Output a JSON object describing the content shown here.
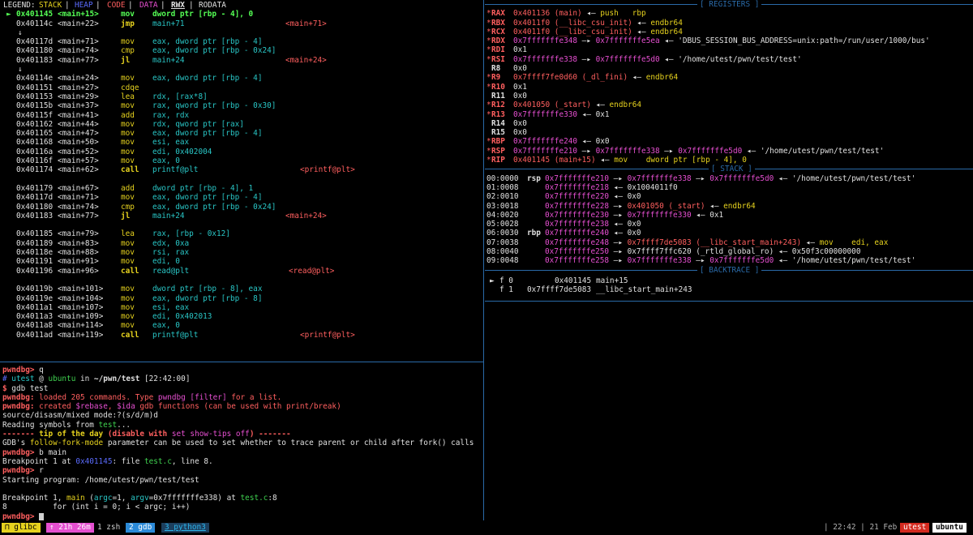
{
  "legend": {
    "label": "LEGEND:",
    "stack": "STACK",
    "heap": "HEAP",
    "code": "CODE",
    "data": "DATA",
    "rwx": "RWX",
    "rodata": "RODATA"
  },
  "disasm": [
    {
      "marker": "►",
      "addr": "0x401145",
      "func": "<main+15>",
      "mnem": "mov",
      "ops": "dword ptr [rbp - 4], 0",
      "tgt": "",
      "current": true
    },
    {
      "marker": "",
      "addr": "0x40114c",
      "func": "<main+22>",
      "mnem": "jmp",
      "ops": "main+71",
      "tgt": "<main+71>"
    },
    {
      "marker": "↓",
      "spacer": true
    },
    {
      "marker": "",
      "addr": "0x40117d",
      "func": "<main+71>",
      "mnem": "mov",
      "ops": "eax, dword ptr [rbp - 4]",
      "tgt": ""
    },
    {
      "marker": "",
      "addr": "0x401180",
      "func": "<main+74>",
      "mnem": "cmp",
      "ops": "eax, dword ptr [rbp - 0x24]",
      "tgt": ""
    },
    {
      "marker": "",
      "addr": "0x401183",
      "func": "<main+77>",
      "mnem": "jl",
      "ops": "main+24",
      "tgt": "<main+24>"
    },
    {
      "marker": "↓",
      "spacer": true
    },
    {
      "marker": "",
      "addr": "0x40114e",
      "func": "<main+24>",
      "mnem": "mov",
      "ops": "eax, dword ptr [rbp - 4]",
      "tgt": ""
    },
    {
      "marker": "",
      "addr": "0x401151",
      "func": "<main+27>",
      "mnem": "cdqe",
      "ops": "",
      "tgt": ""
    },
    {
      "marker": "",
      "addr": "0x401153",
      "func": "<main+29>",
      "mnem": "lea",
      "ops": "rdx, [rax*8]",
      "tgt": ""
    },
    {
      "marker": "",
      "addr": "0x40115b",
      "func": "<main+37>",
      "mnem": "mov",
      "ops": "rax, qword ptr [rbp - 0x30]",
      "tgt": ""
    },
    {
      "marker": "",
      "addr": "0x40115f",
      "func": "<main+41>",
      "mnem": "add",
      "ops": "rax, rdx",
      "tgt": ""
    },
    {
      "marker": "",
      "addr": "0x401162",
      "func": "<main+44>",
      "mnem": "mov",
      "ops": "rdx, qword ptr [rax]",
      "tgt": ""
    },
    {
      "marker": "",
      "addr": "0x401165",
      "func": "<main+47>",
      "mnem": "mov",
      "ops": "eax, dword ptr [rbp - 4]",
      "tgt": ""
    },
    {
      "marker": "",
      "addr": "0x401168",
      "func": "<main+50>",
      "mnem": "mov",
      "ops": "esi, eax",
      "tgt": ""
    },
    {
      "marker": "",
      "addr": "0x40116a",
      "func": "<main+52>",
      "mnem": "mov",
      "ops": "edi, 0x402004",
      "tgt": ""
    },
    {
      "marker": "",
      "addr": "0x40116f",
      "func": "<main+57>",
      "mnem": "mov",
      "ops": "eax, 0",
      "tgt": ""
    },
    {
      "marker": "",
      "addr": "0x401174",
      "func": "<main+62>",
      "mnem": "call",
      "ops": "printf@plt",
      "tgt": "<printf@plt>"
    },
    {
      "spacer": true,
      "marker": ""
    },
    {
      "marker": "",
      "addr": "0x401179",
      "func": "<main+67>",
      "mnem": "add",
      "ops": "dword ptr [rbp - 4], 1",
      "tgt": ""
    },
    {
      "marker": "",
      "addr": "0x40117d",
      "func": "<main+71>",
      "mnem": "mov",
      "ops": "eax, dword ptr [rbp - 4]",
      "tgt": ""
    },
    {
      "marker": "",
      "addr": "0x401180",
      "func": "<main+74>",
      "mnem": "cmp",
      "ops": "eax, dword ptr [rbp - 0x24]",
      "tgt": ""
    },
    {
      "marker": "",
      "addr": "0x401183",
      "func": "<main+77>",
      "mnem": "jl",
      "ops": "main+24",
      "tgt": "<main+24>"
    },
    {
      "spacer": true,
      "marker": ""
    },
    {
      "marker": "",
      "addr": "0x401185",
      "func": "<main+79>",
      "mnem": "lea",
      "ops": "rax, [rbp - 0x12]",
      "tgt": ""
    },
    {
      "marker": "",
      "addr": "0x401189",
      "func": "<main+83>",
      "mnem": "mov",
      "ops": "edx, 0xa",
      "tgt": ""
    },
    {
      "marker": "",
      "addr": "0x40118e",
      "func": "<main+88>",
      "mnem": "mov",
      "ops": "rsi, rax",
      "tgt": ""
    },
    {
      "marker": "",
      "addr": "0x401191",
      "func": "<main+91>",
      "mnem": "mov",
      "ops": "edi, 0",
      "tgt": ""
    },
    {
      "marker": "",
      "addr": "0x401196",
      "func": "<main+96>",
      "mnem": "call",
      "ops": "read@plt",
      "tgt": "<read@plt>"
    },
    {
      "spacer": true,
      "marker": ""
    },
    {
      "marker": "",
      "addr": "0x40119b",
      "func": "<main+101>",
      "mnem": "mov",
      "ops": "dword ptr [rbp - 8], eax",
      "tgt": ""
    },
    {
      "marker": "",
      "addr": "0x40119e",
      "func": "<main+104>",
      "mnem": "mov",
      "ops": "eax, dword ptr [rbp - 8]",
      "tgt": ""
    },
    {
      "marker": "",
      "addr": "0x4011a1",
      "func": "<main+107>",
      "mnem": "mov",
      "ops": "esi, eax",
      "tgt": ""
    },
    {
      "marker": "",
      "addr": "0x4011a3",
      "func": "<main+109>",
      "mnem": "mov",
      "ops": "edi, 0x402013",
      "tgt": ""
    },
    {
      "marker": "",
      "addr": "0x4011a8",
      "func": "<main+114>",
      "mnem": "mov",
      "ops": "eax, 0",
      "tgt": ""
    },
    {
      "marker": "",
      "addr": "0x4011ad",
      "func": "<main+119>",
      "mnem": "call",
      "ops": "printf@plt",
      "tgt": "<printf@plt>"
    }
  ],
  "gdb": {
    "lines": [
      {
        "prompt": "pwndbg>",
        "text": " q"
      },
      {
        "raw": [
          [
            "# ",
            "blue"
          ],
          [
            "utest",
            "cyan"
          ],
          [
            " @ ",
            "wht"
          ],
          [
            "ubuntu",
            "grn"
          ],
          [
            " in ",
            "wht"
          ],
          [
            "~/pwn/test",
            "wht bold"
          ],
          [
            " [22:42:00]",
            "wht"
          ]
        ]
      },
      {
        "raw": [
          [
            "$ ",
            "red bold"
          ],
          [
            "gdb test",
            "wht"
          ]
        ]
      },
      {
        "raw": [
          [
            "pwndbg:",
            "red bold"
          ],
          [
            " loaded 205 commands. Type ",
            "red"
          ],
          [
            "pwndbg [filter]",
            "mag"
          ],
          [
            " for a list.",
            "red"
          ]
        ]
      },
      {
        "raw": [
          [
            "pwndbg:",
            "red bold"
          ],
          [
            " created ",
            "red"
          ],
          [
            "$rebase",
            "mag"
          ],
          [
            ", ",
            "red"
          ],
          [
            "$ida",
            "mag"
          ],
          [
            " gdb functions (can be used with print/break)",
            "red"
          ]
        ]
      },
      {
        "raw": [
          [
            "source/disasm/mixed mode:?(s/d/m)d",
            "wht"
          ]
        ]
      },
      {
        "raw": [
          [
            "Reading symbols from ",
            "wht"
          ],
          [
            "test",
            "grn"
          ],
          [
            "...",
            "wht"
          ]
        ]
      },
      {
        "raw": [
          [
            "------- ",
            "red bold"
          ],
          [
            "tip of the day",
            "yel bold"
          ],
          [
            " (disable with ",
            "red bold"
          ],
          [
            "set show-tips off",
            "mag"
          ],
          [
            ") -------",
            "red bold"
          ]
        ]
      },
      {
        "raw": [
          [
            "GDB's ",
            "wht"
          ],
          [
            "follow-fork-mode",
            "yel"
          ],
          [
            " parameter can be used to set whether to trace parent or child after fork() calls",
            "wht"
          ]
        ]
      },
      {
        "prompt": "pwndbg>",
        "text": " b main"
      },
      {
        "raw": [
          [
            "Breakpoint 1 at ",
            "wht"
          ],
          [
            "0x401145",
            "blue"
          ],
          [
            ": file ",
            "wht"
          ],
          [
            "test.c",
            "grn"
          ],
          [
            ", line 8.",
            "wht"
          ]
        ]
      },
      {
        "prompt": "pwndbg>",
        "text": " r"
      },
      {
        "raw": [
          [
            "Starting program: /home/utest/pwn/test/test",
            "wht"
          ]
        ]
      },
      {
        "raw": [
          [
            "",
            ""
          ]
        ]
      },
      {
        "raw": [
          [
            "Breakpoint 1, ",
            "wht"
          ],
          [
            "main",
            "yel"
          ],
          [
            " (",
            "wht"
          ],
          [
            "argc",
            "cyan"
          ],
          [
            "=1, ",
            "wht"
          ],
          [
            "argv",
            "cyan"
          ],
          [
            "=0x7fffffffe338) at ",
            "wht"
          ],
          [
            "test.c",
            "grn"
          ],
          [
            ":8",
            "wht"
          ]
        ]
      },
      {
        "raw": [
          [
            "8          for (int i = 0; i < argc; i++)",
            "wht"
          ]
        ]
      },
      {
        "prompt": "pwndbg>",
        "text": " ",
        "cursor": true
      }
    ]
  },
  "registers": {
    "title": "REGISTERS",
    "rows": [
      {
        "star": true,
        "name": "RAX",
        "parts": [
          [
            "0x401136 (main)",
            "red"
          ],
          [
            " ◂— ",
            "wht"
          ],
          [
            "push   rbp",
            "yel"
          ]
        ]
      },
      {
        "star": true,
        "name": "RBX",
        "parts": [
          [
            "0x4011f0 (__libc_csu_init)",
            "red"
          ],
          [
            " ◂— ",
            "wht"
          ],
          [
            "endbr64",
            "yel"
          ]
        ]
      },
      {
        "star": true,
        "name": "RCX",
        "parts": [
          [
            "0x4011f0 (__libc_csu_init)",
            "red"
          ],
          [
            " ◂— ",
            "wht"
          ],
          [
            "endbr64",
            "yel"
          ]
        ]
      },
      {
        "star": true,
        "name": "RDX",
        "parts": [
          [
            "0x7fffffffe348",
            "mag"
          ],
          [
            " —▸ ",
            "wht"
          ],
          [
            "0x7fffffffe5ea",
            "mag"
          ],
          [
            " ◂— 'DBUS_SESSION_BUS_ADDRESS=unix:path=/run/user/1000/bus'",
            "wht"
          ]
        ]
      },
      {
        "star": true,
        "name": "RDI",
        "parts": [
          [
            "0x1",
            "wht"
          ]
        ]
      },
      {
        "star": true,
        "name": "RSI",
        "parts": [
          [
            "0x7fffffffe338",
            "mag"
          ],
          [
            " —▸ ",
            "wht"
          ],
          [
            "0x7fffffffe5d0",
            "mag"
          ],
          [
            " ◂— '/home/utest/pwn/test/test'",
            "wht"
          ]
        ]
      },
      {
        "star": false,
        "name": "R8",
        "parts": [
          [
            "0x0",
            "wht"
          ]
        ]
      },
      {
        "star": true,
        "name": "R9",
        "parts": [
          [
            "0x7ffff7fe0d60 (_dl_fini)",
            "red"
          ],
          [
            " ◂— ",
            "wht"
          ],
          [
            "endbr64",
            "yel"
          ]
        ]
      },
      {
        "star": true,
        "name": "R10",
        "parts": [
          [
            "0x1",
            "wht"
          ]
        ]
      },
      {
        "star": false,
        "name": "R11",
        "parts": [
          [
            "0x0",
            "wht"
          ]
        ]
      },
      {
        "star": true,
        "name": "R12",
        "parts": [
          [
            "0x401050 (_start)",
            "red"
          ],
          [
            " ◂— ",
            "wht"
          ],
          [
            "endbr64",
            "yel"
          ]
        ]
      },
      {
        "star": true,
        "name": "R13",
        "parts": [
          [
            "0x7fffffffe330",
            "mag"
          ],
          [
            " ◂— 0x1",
            "wht"
          ]
        ]
      },
      {
        "star": false,
        "name": "R14",
        "parts": [
          [
            "0x0",
            "wht"
          ]
        ]
      },
      {
        "star": false,
        "name": "R15",
        "parts": [
          [
            "0x0",
            "wht"
          ]
        ]
      },
      {
        "star": true,
        "name": "RBP",
        "parts": [
          [
            "0x7fffffffe240",
            "mag"
          ],
          [
            " ◂— 0x0",
            "wht"
          ]
        ]
      },
      {
        "star": true,
        "name": "RSP",
        "parts": [
          [
            "0x7fffffffe210",
            "mag"
          ],
          [
            " —▸ ",
            "wht"
          ],
          [
            "0x7fffffffe338",
            "mag"
          ],
          [
            " —▸ ",
            "wht"
          ],
          [
            "0x7fffffffe5d0",
            "mag"
          ],
          [
            " ◂— '/home/utest/pwn/test/test'",
            "wht"
          ]
        ]
      },
      {
        "star": true,
        "name": "RIP",
        "parts": [
          [
            "0x401145 (main+15)",
            "red"
          ],
          [
            " ◂— ",
            "wht"
          ],
          [
            "mov    dword ptr [rbp - 4], 0",
            "yel"
          ]
        ]
      }
    ]
  },
  "stack": {
    "title": "STACK",
    "rows": [
      {
        "off": "00:0000",
        "reg": "rsp",
        "parts": [
          [
            "0x7fffffffe210",
            "mag"
          ],
          [
            " —▸ ",
            "wht"
          ],
          [
            "0x7fffffffe338",
            "mag"
          ],
          [
            " —▸ ",
            "wht"
          ],
          [
            "0x7fffffffe5d0",
            "mag"
          ],
          [
            " ◂— '/home/utest/pwn/test/test'",
            "wht"
          ]
        ]
      },
      {
        "off": "01:0008",
        "reg": "",
        "parts": [
          [
            "0x7fffffffe218",
            "mag"
          ],
          [
            " ◂— 0x1004011f0",
            "wht"
          ]
        ]
      },
      {
        "off": "02:0010",
        "reg": "",
        "parts": [
          [
            "0x7fffffffe220",
            "mag"
          ],
          [
            " ◂— 0x0",
            "wht"
          ]
        ]
      },
      {
        "off": "03:0018",
        "reg": "",
        "parts": [
          [
            "0x7fffffffe228",
            "mag"
          ],
          [
            " —▸ ",
            "wht"
          ],
          [
            "0x401050 (_start)",
            "red"
          ],
          [
            " ◂— ",
            "wht"
          ],
          [
            "endbr64",
            "yel"
          ]
        ]
      },
      {
        "off": "04:0020",
        "reg": "",
        "parts": [
          [
            "0x7fffffffe230",
            "mag"
          ],
          [
            " —▸ ",
            "wht"
          ],
          [
            "0x7fffffffe330",
            "mag"
          ],
          [
            " ◂— 0x1",
            "wht"
          ]
        ]
      },
      {
        "off": "05:0028",
        "reg": "",
        "parts": [
          [
            "0x7fffffffe238",
            "mag"
          ],
          [
            " ◂— 0x0",
            "wht"
          ]
        ]
      },
      {
        "off": "06:0030",
        "reg": "rbp",
        "parts": [
          [
            "0x7fffffffe240",
            "mag"
          ],
          [
            " ◂— 0x0",
            "wht"
          ]
        ]
      },
      {
        "off": "07:0038",
        "reg": "",
        "parts": [
          [
            "0x7fffffffe248",
            "mag"
          ],
          [
            " —▸ ",
            "wht"
          ],
          [
            "0x7ffff7de5083 (__libc_start_main+243)",
            "red"
          ],
          [
            " ◂— ",
            "wht"
          ],
          [
            "mov    edi, eax",
            "yel"
          ]
        ]
      },
      {
        "off": "08:0040",
        "reg": "",
        "parts": [
          [
            "0x7fffffffe250",
            "mag"
          ],
          [
            " —▸ 0x7ffff7ffc620 (_rtld_global_ro) ◂— 0x50f3c00000000",
            "wht"
          ]
        ]
      },
      {
        "off": "09:0048",
        "reg": "",
        "parts": [
          [
            "0x7fffffffe258",
            "mag"
          ],
          [
            " —▸ ",
            "wht"
          ],
          [
            "0x7fffffffe338",
            "mag"
          ],
          [
            " —▸ ",
            "wht"
          ],
          [
            "0x7fffffffe5d0",
            "mag"
          ],
          [
            " ◂— '/home/utest/pwn/test/test'",
            "wht"
          ]
        ]
      }
    ]
  },
  "backtrace": {
    "title": "BACKTRACE",
    "rows": [
      {
        "mark": "►",
        "frame": "f 0",
        "addr": "0x401145",
        "sym": "main+15"
      },
      {
        "mark": "",
        "frame": "f 1",
        "addr": "0x7ffff7de5083",
        "sym": "__libc_start_main+243"
      }
    ]
  },
  "statusbar": {
    "session": "glibc",
    "uptime": "21h 26m",
    "windows": [
      {
        "label": "1 zsh",
        "active": false
      },
      {
        "label": "2 gdb",
        "active": true
      },
      {
        "label": "3 python3",
        "active": false
      }
    ],
    "clock": "| 22:42 | 21 Feb",
    "user": "utest",
    "host": "ubuntu"
  },
  "colors": {
    "accent": "#2a6aa8",
    "red": "#ff5f5f",
    "yellow": "#e6d21e",
    "magenta": "#e54fd0",
    "green": "#3fd04f"
  }
}
